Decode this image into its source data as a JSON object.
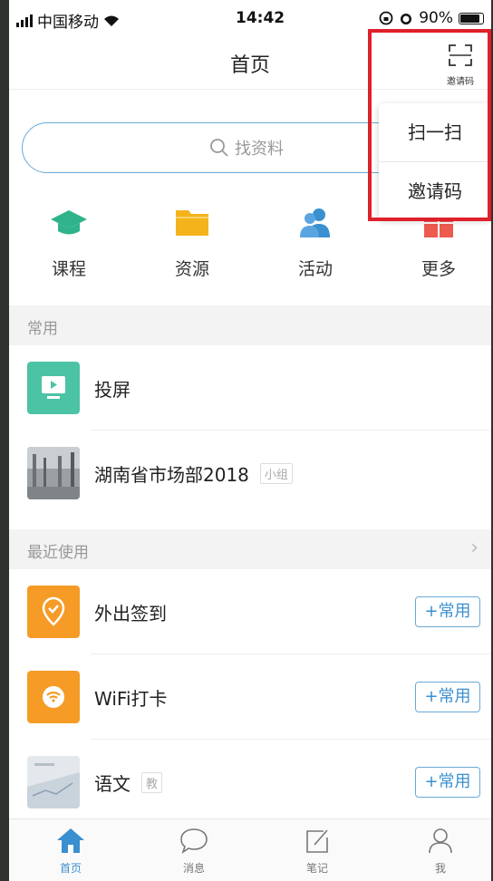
{
  "status": {
    "carrier": "中国移动",
    "time": "14:42",
    "battery": "90%"
  },
  "nav": {
    "title": "首页",
    "scan_label": "邀请码"
  },
  "search": {
    "placeholder": "找资料"
  },
  "categories": [
    {
      "label": "课程",
      "icon": "graduation-cap-icon",
      "color": "#2fb38a"
    },
    {
      "label": "资源",
      "icon": "folder-icon",
      "color": "#f5b31b"
    },
    {
      "label": "活动",
      "icon": "people-icon",
      "color": "#3a8fd0"
    },
    {
      "label": "更多",
      "icon": "grid-icon",
      "color": "#ee5a4e"
    }
  ],
  "sections": {
    "common": {
      "title": "常用"
    },
    "recent": {
      "title": "最近使用",
      "chevron": "›"
    }
  },
  "common_items": [
    {
      "label": "投屏",
      "icon": "screen-cast-icon"
    },
    {
      "label": "湖南省市场部2018",
      "tag": "小组",
      "icon": "group-photo-icon"
    }
  ],
  "recent_items": [
    {
      "label": "外出签到",
      "button": "+常用",
      "icon": "location-checkin-icon"
    },
    {
      "label": "WiFi打卡",
      "button": "+常用",
      "icon": "wifi-icon"
    },
    {
      "label": "语文",
      "tag": "教",
      "button": "+常用",
      "icon": "course-cover-icon"
    }
  ],
  "popup": {
    "items": [
      "扫一扫",
      "邀请码"
    ]
  },
  "tabbar": [
    {
      "label": "首页",
      "icon": "home-icon",
      "active": true
    },
    {
      "label": "消息",
      "icon": "chat-bubble-icon",
      "active": false
    },
    {
      "label": "笔记",
      "icon": "note-edit-icon",
      "active": false
    },
    {
      "label": "我",
      "icon": "person-icon",
      "active": false
    }
  ],
  "colors": {
    "accent": "#3a8fd0",
    "highlight": "#e0202a",
    "orange": "#f59b26",
    "teal": "#4cc3a5"
  }
}
